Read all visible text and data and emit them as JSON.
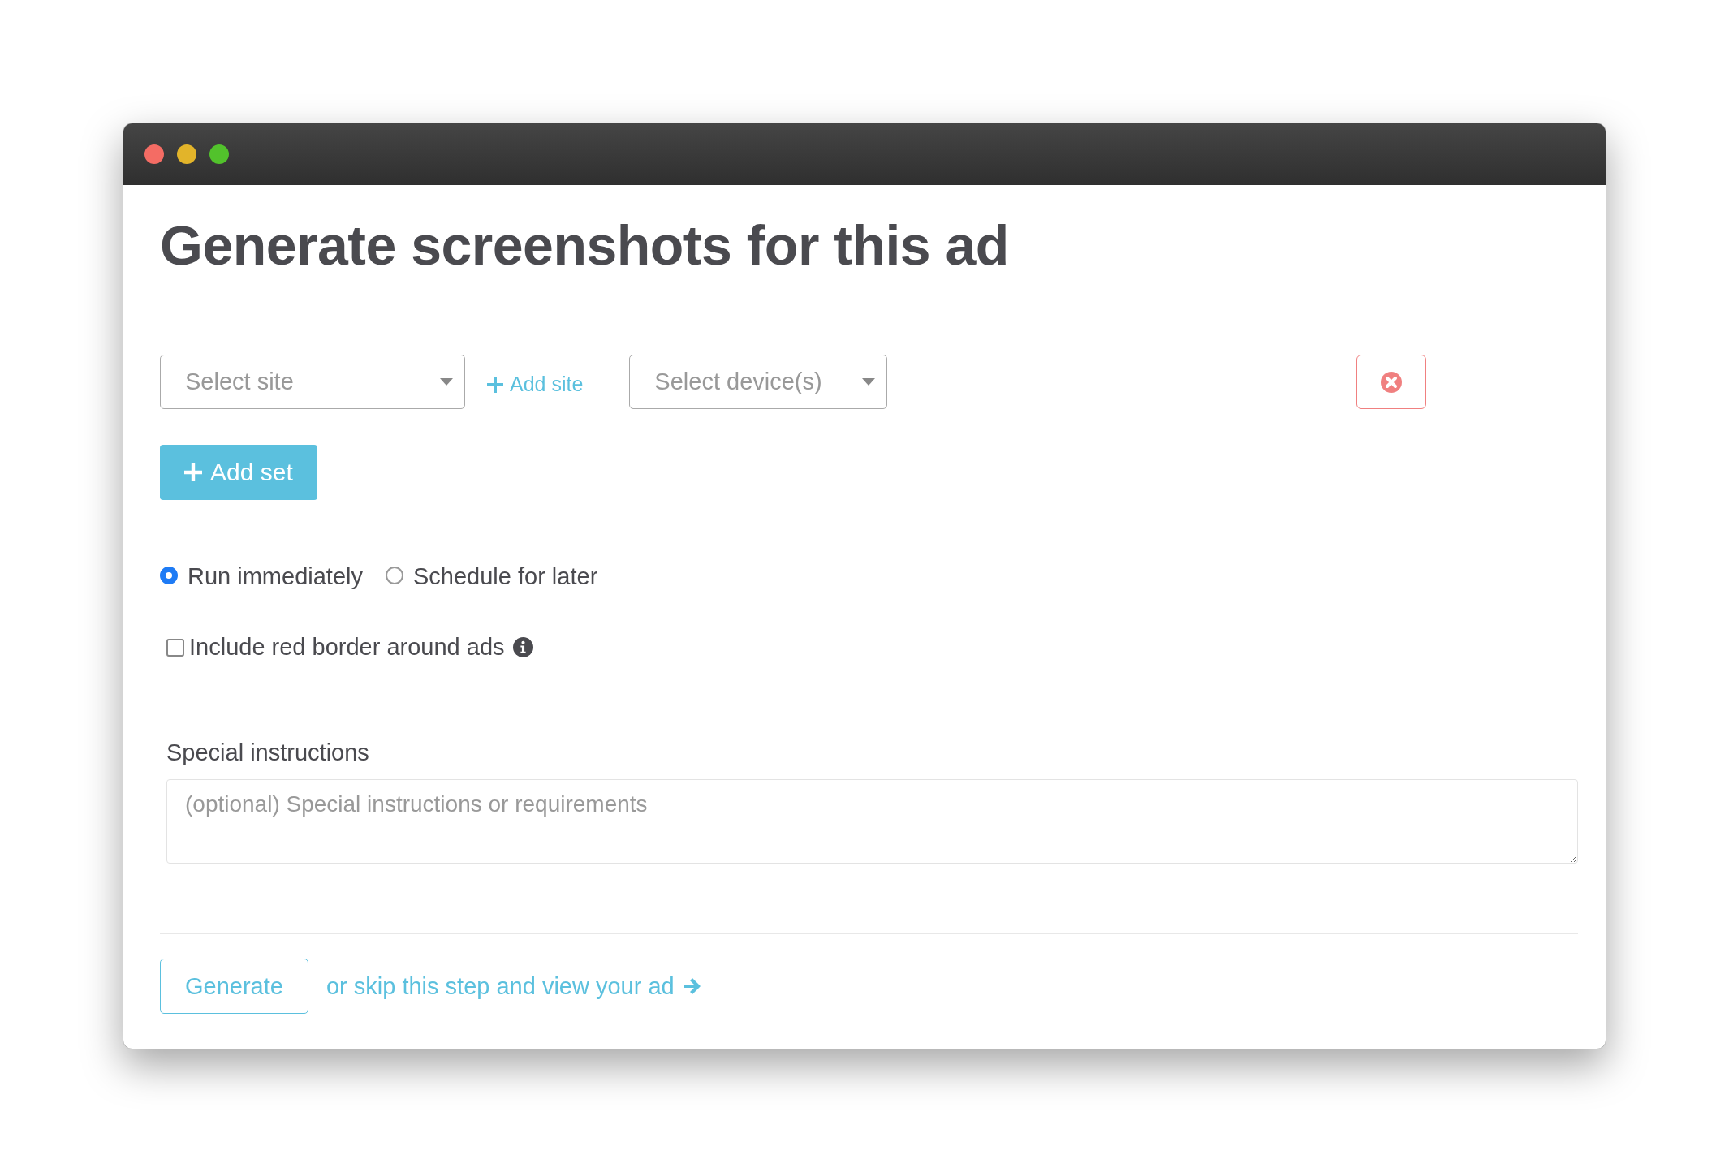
{
  "window": {
    "title": "Generate screenshots for this ad"
  },
  "site_select": {
    "placeholder": "Select site"
  },
  "add_site": {
    "label": "Add site"
  },
  "device_select": {
    "placeholder": "Select device(s)"
  },
  "add_set": {
    "label": "Add set"
  },
  "run_options": [
    {
      "label": "Run immediately",
      "selected": true
    },
    {
      "label": "Schedule for later",
      "selected": false
    }
  ],
  "red_border": {
    "label": "Include red border around ads",
    "checked": false
  },
  "special_instructions": {
    "label": "Special instructions",
    "placeholder": "(optional) Special instructions or requirements"
  },
  "generate": {
    "label": "Generate"
  },
  "skip_link": {
    "label": "or skip this step and view your ad"
  }
}
